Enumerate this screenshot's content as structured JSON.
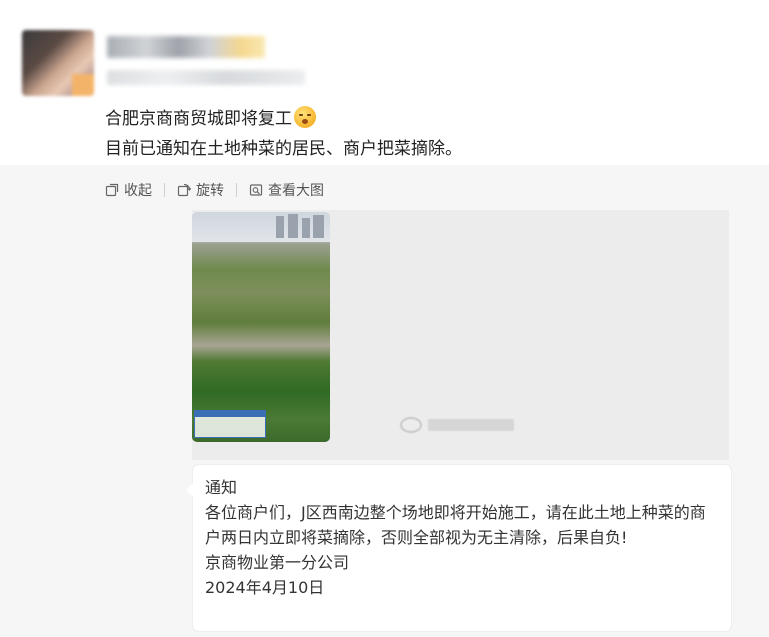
{
  "post": {
    "text_line1": "合肥京商商贸城即将复工",
    "emoji": "flushed-face-emoji",
    "text_line2": "目前已通知在土地种菜的居民、商户把菜摘除。"
  },
  "toolbar": {
    "collapse_label": "收起",
    "rotate_label": "旋转",
    "view_large_label": "查看大图"
  },
  "notice": {
    "title": "通知",
    "body": "各位商户们，J区西南边整个场地即将开始施工，请在此土地上种菜的商户两日内立即将菜摘除，否则全部视为无主清除，后果自负!",
    "signature": "京商物业第一分公司",
    "date": "2024年4月10日"
  },
  "colors": {
    "media_background": "#f6f6f6",
    "text": "#222222",
    "toolbar_text": "#555555"
  }
}
